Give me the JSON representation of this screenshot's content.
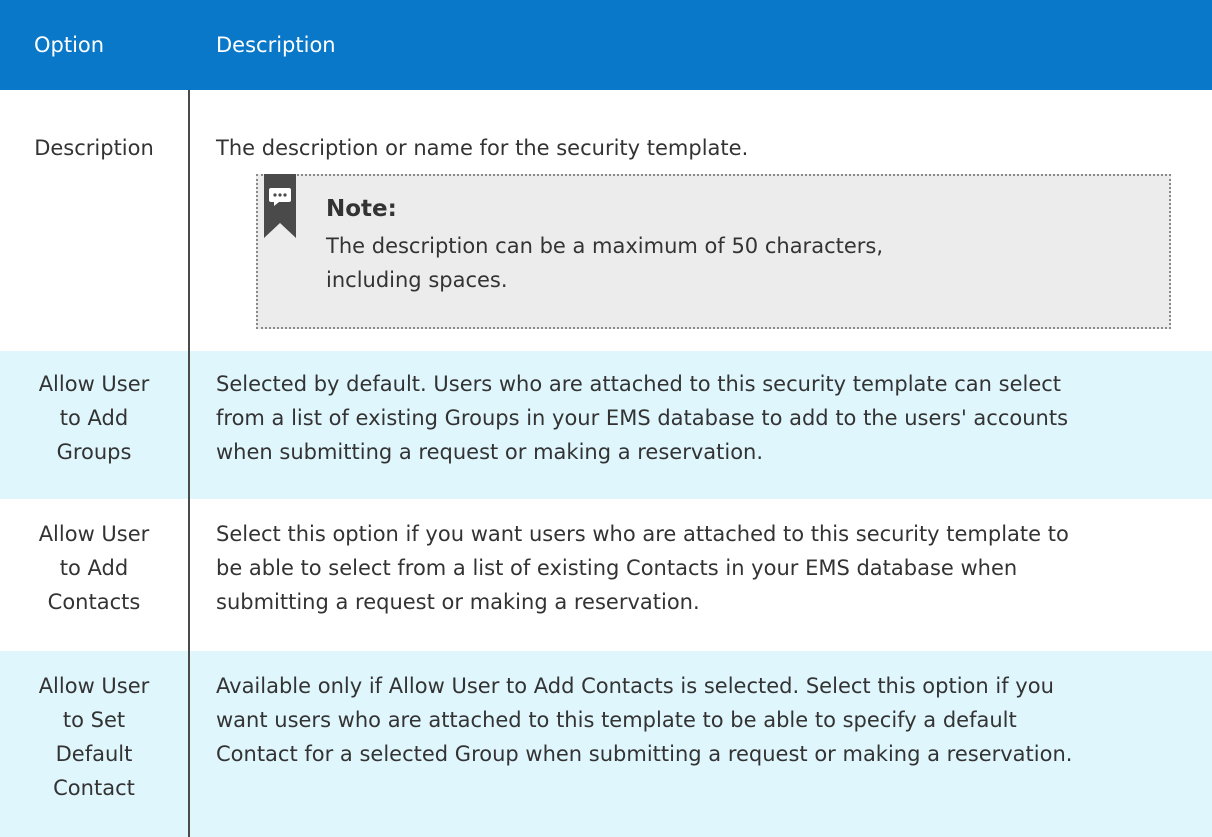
{
  "table": {
    "headers": {
      "option": "Option",
      "description": "Description"
    },
    "rows": [
      {
        "option": "Description",
        "description": "The description or name for the security template.",
        "note": {
          "icon": "comment-note-icon",
          "title": "Note:",
          "text_line1": "The description can be a maximum of 50 characters,",
          "text_line2": "including spaces."
        }
      },
      {
        "option_lines": [
          "Allow User",
          "to Add",
          "Groups"
        ],
        "description_lines": [
          "Selected by default. Users who are attached to this security template can select",
          "from a list of existing Groups in your EMS database to add to the users' accounts",
          "when submitting a request or making a reservation."
        ]
      },
      {
        "option_lines": [
          "Allow User",
          "to Add",
          "Contacts"
        ],
        "description_lines": [
          "Select this option if you want users who are attached to this security template to",
          "be able to select from a list of existing Contacts in your EMS database when",
          "submitting a request or making a reservation."
        ]
      },
      {
        "option_lines": [
          "Allow User",
          "to Set",
          "Default",
          "Contact"
        ],
        "description_lines": [
          "Available only if Allow User to Add Contacts is selected. Select this option if you",
          "want users who are attached to this template to be able to specify a default",
          "Contact for a selected Group when submitting a request or making a reservation."
        ]
      }
    ]
  },
  "colors": {
    "header_bg": "#0a78c8",
    "shaded_row_bg": "#dff6fd",
    "note_bg": "#ececec",
    "text": "#333333"
  }
}
